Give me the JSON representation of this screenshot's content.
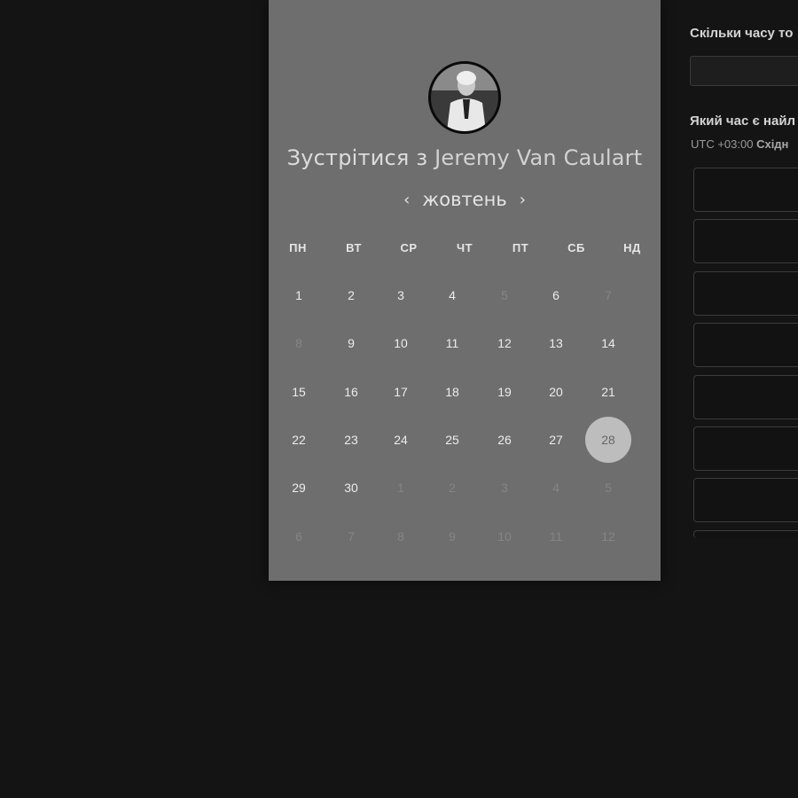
{
  "booking": {
    "title_prefix": "Зустрітися з",
    "host_name": "Jeremy Van Caulart"
  },
  "calendar": {
    "month": "жовтень",
    "prev_icon": "chevron-left-icon",
    "next_icon": "chevron-right-icon",
    "weekdays": [
      "ПН",
      "ВТ",
      "СР",
      "ЧТ",
      "ПТ",
      "СБ",
      "НД"
    ],
    "weeks": [
      [
        {
          "d": "1"
        },
        {
          "d": "2"
        },
        {
          "d": "3"
        },
        {
          "d": "4"
        },
        {
          "d": "5",
          "dim": true
        },
        {
          "d": "6"
        },
        {
          "d": "7",
          "dim": true
        }
      ],
      [
        {
          "d": "8",
          "dim": true
        },
        {
          "d": "9"
        },
        {
          "d": "10"
        },
        {
          "d": "11"
        },
        {
          "d": "12"
        },
        {
          "d": "13"
        },
        {
          "d": "14"
        }
      ],
      [
        {
          "d": "15"
        },
        {
          "d": "16"
        },
        {
          "d": "17"
        },
        {
          "d": "18"
        },
        {
          "d": "19"
        },
        {
          "d": "20"
        },
        {
          "d": "21"
        }
      ],
      [
        {
          "d": "22"
        },
        {
          "d": "23"
        },
        {
          "d": "24"
        },
        {
          "d": "25"
        },
        {
          "d": "26"
        },
        {
          "d": "27"
        },
        {
          "d": "28",
          "selected": true
        }
      ],
      [
        {
          "d": "29"
        },
        {
          "d": "30"
        },
        {
          "d": "1",
          "dim": true
        },
        {
          "d": "2",
          "dim": true
        },
        {
          "d": "3",
          "dim": true
        },
        {
          "d": "4",
          "dim": true
        },
        {
          "d": "5",
          "dim": true
        }
      ],
      [
        {
          "d": "6",
          "dim": true
        },
        {
          "d": "7",
          "dim": true
        },
        {
          "d": "8",
          "dim": true
        },
        {
          "d": "9",
          "dim": true
        },
        {
          "d": "10",
          "dim": true
        },
        {
          "d": "11",
          "dim": true
        },
        {
          "d": "12",
          "dim": true
        }
      ]
    ]
  },
  "right": {
    "duration_label": "Скільки часу то",
    "time_label": "Який час є найл",
    "timezone_offset": "UTC +03:00",
    "timezone_name": "Східн",
    "slot_count": 8
  }
}
